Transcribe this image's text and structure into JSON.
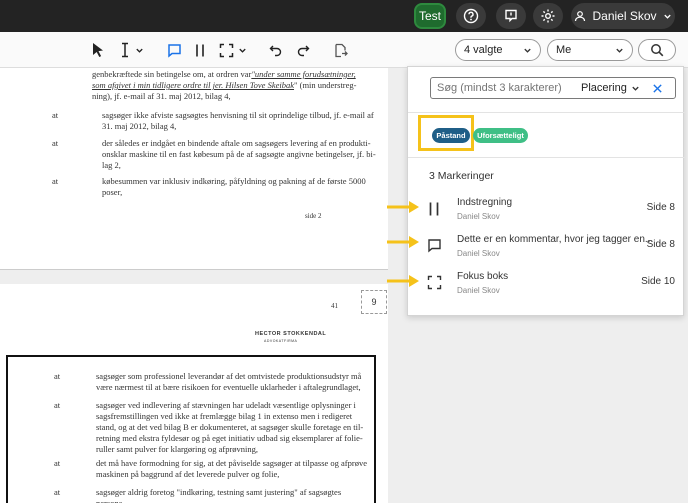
{
  "topbar": {
    "test_label": "Test",
    "user_name": "Daniel Skov"
  },
  "toolbar": {
    "filter_select": "4 valgte",
    "user_select": "Me"
  },
  "document": {
    "page1": {
      "lines": [
        "genbekræftede sin betingelse om, at ordren var ",
        "som afgivet i min tidligere ordre til jer. Hilsen Tove Skeibak",
        "ning), jf. e-mail af 31. maj 2012, bilag 4,"
      ],
      "quote_a": "\"under samme forudsætninger,",
      "quote_b": "\" (min understreg-",
      "items": [
        {
          "label": "at",
          "text1": "sagsøger ikke afviste sagsøgtes henvisning til sit oprindelige tilbud, jf. e-mail af",
          "text2": "31. maj 2012, bilag 4,",
          "text3": ""
        },
        {
          "label": "at",
          "text1": "der således er indgået en bindende aftale om sagsøgers levering af en produkti-",
          "text2": "onsklar maskine til en fast købesum på de af sagsøgte angivne betingelser, jf. bi-",
          "text3": "lag 2,"
        },
        {
          "label": "at",
          "text1": "købesummen var inklusiv indkøring, påfyldning og pakning af de første 5000",
          "text2": "poser,",
          "text3": ""
        }
      ],
      "footer": "side 2"
    },
    "page2": {
      "page_no": "41",
      "badge": "9",
      "header": "HECTOR  STOKKENDAL",
      "subheader": "ADVOKATFIRMA",
      "items": [
        {
          "label": "at",
          "text1": "sagsøger som professionel leverandør af det omtvistede produktionsudstyr må",
          "text2": "være nærmest til at bære risikoen for eventuelle uklarheder i aftalegrundlaget,",
          "text3": "",
          "text4": "",
          "text5": ""
        },
        {
          "label": "at",
          "text1": "sagsøger ved indlevering af stævningen har udeladt væsentlige oplysninger i",
          "text2": "sagsfremstillingen ved ikke at fremlægge bilag 1 in extenso men i redigeret",
          "text3": "stand, og at det ved bilag B er dokumenteret, at sagsøger skulle foretage en til-",
          "text4": "retning med ekstra fyldesør og på eget initiativ udbad sig eksemplarer af folie-",
          "text5": "ruller samt pulver for klargøring og afprøvning,"
        },
        {
          "label": "at",
          "text1": "det må have formodning for sig, at det påviselde sagsøger at tilpasse og afprøve",
          "text2": "maskinen på baggrund af det leverede pulver og folie,",
          "text3": "",
          "text4": "",
          "text5": ""
        },
        {
          "label": "at",
          "text1": "sagsøger aldrig foretog \"indkøring, testning samt justering\" af sagsøgtes persona-",
          "text2": "",
          "text3": "",
          "text4": "",
          "text5": ""
        }
      ]
    }
  },
  "panel": {
    "search_placeholder": "Søg (mindst 3 karakterer)",
    "placement_label": "Placering",
    "tags": [
      {
        "label": "Påstand",
        "color": "#1f5e87"
      },
      {
        "label": "Uforsætteligt",
        "color": "#3fbf86"
      }
    ],
    "count_label": "3 Markeringer",
    "items": [
      {
        "icon": "strikethrough-icon",
        "title": "Indstregning",
        "author": "Daniel Skov",
        "page": "Side 8"
      },
      {
        "icon": "comment-icon",
        "title": "Dette er en kommentar, hvor jeg tagger en...",
        "author": "Daniel Skov",
        "page": "Side 8"
      },
      {
        "icon": "focus-box-icon",
        "title": "Fokus boks",
        "author": "Daniel Skov",
        "page": "Side 10"
      }
    ]
  },
  "colors": {
    "highlight_yellow": "#f5c21a",
    "accent_blue": "#1a73e8",
    "topbar": "#232323",
    "test_green": "#1f6b2e"
  }
}
